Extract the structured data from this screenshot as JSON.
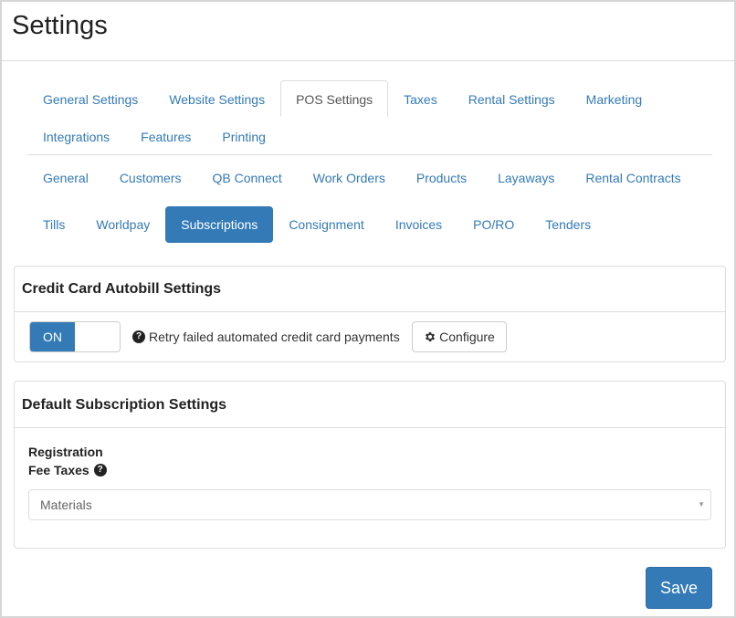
{
  "page": {
    "title": "Settings"
  },
  "tabs": [
    {
      "label": "General Settings",
      "active": false
    },
    {
      "label": "Website Settings",
      "active": false
    },
    {
      "label": "POS Settings",
      "active": true
    },
    {
      "label": "Taxes",
      "active": false
    },
    {
      "label": "Rental Settings",
      "active": false
    },
    {
      "label": "Marketing",
      "active": false
    },
    {
      "label": "Integrations",
      "active": false
    },
    {
      "label": "Features",
      "active": false
    },
    {
      "label": "Printing",
      "active": false
    }
  ],
  "subtabs": [
    {
      "label": "General",
      "active": false
    },
    {
      "label": "Customers",
      "active": false
    },
    {
      "label": "QB Connect",
      "active": false
    },
    {
      "label": "Work Orders",
      "active": false
    },
    {
      "label": "Products",
      "active": false
    },
    {
      "label": "Layaways",
      "active": false
    },
    {
      "label": "Rental Contracts",
      "active": false
    },
    {
      "label": "Tills",
      "active": false
    },
    {
      "label": "Worldpay",
      "active": false
    },
    {
      "label": "Subscriptions",
      "active": true
    },
    {
      "label": "Consignment",
      "active": false
    },
    {
      "label": "Invoices",
      "active": false
    },
    {
      "label": "PO/RO",
      "active": false
    },
    {
      "label": "Tenders",
      "active": false
    }
  ],
  "autobill": {
    "heading": "Credit Card Autobill Settings",
    "toggle_label": "ON",
    "toggle_state": "on",
    "help_icon_glyph": "?",
    "retry_label": "Retry failed automated credit card payments",
    "configure_label": "Configure",
    "configure_icon": "gear-icon"
  },
  "defaults": {
    "heading": "Default Subscription Settings",
    "reg_label_line1": "Registration",
    "reg_label_line2": "Fee Taxes",
    "help_icon_glyph": "?",
    "select_value": "Materials",
    "select_arrow_glyph": "▼"
  },
  "actions": {
    "save_label": "Save"
  },
  "colors": {
    "accent": "#337ab7",
    "border": "#dddddd",
    "text": "#333333"
  }
}
